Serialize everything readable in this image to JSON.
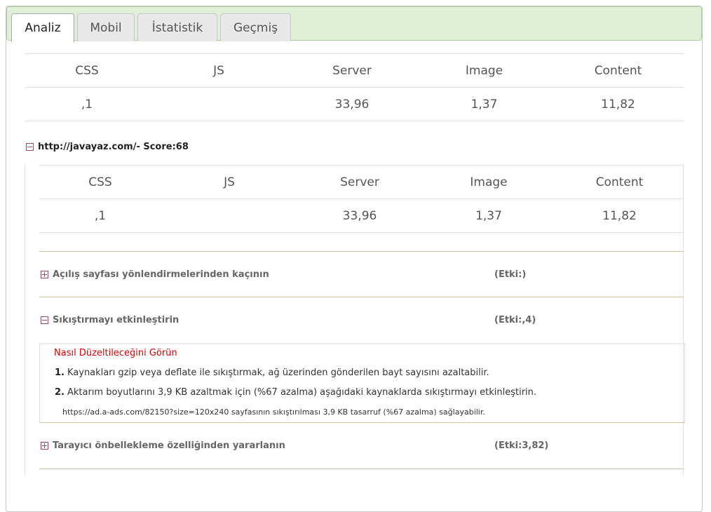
{
  "tabs": [
    {
      "label": "Analiz",
      "active": true
    },
    {
      "label": "Mobil",
      "active": false
    },
    {
      "label": "İstatistik",
      "active": false
    },
    {
      "label": "Geçmiş",
      "active": false
    }
  ],
  "summary": {
    "headers": [
      "CSS",
      "JS",
      "Server",
      "Image",
      "Content"
    ],
    "values": [
      ",1",
      "",
      "33,96",
      "1,37",
      "11,82"
    ]
  },
  "site": {
    "title": "http://javayaz.com/- Score:68",
    "headers": [
      "CSS",
      "JS",
      "Server",
      "Image",
      "Content"
    ],
    "values": [
      ",1",
      "",
      "33,96",
      "1,37",
      "11,82"
    ]
  },
  "rules": [
    {
      "title": "Açılış sayfası yönlendirmelerinden kaçının",
      "impact": "(Etki:)",
      "expanded": false
    },
    {
      "title": "Sıkıştırmayı etkinleştirin",
      "impact": "(Etki:,4)",
      "expanded": true
    },
    {
      "title": "Tarayıcı önbellekleme özelliğinden yararlanın",
      "impact": "(Etki:3,82)",
      "expanded": false
    }
  ],
  "detail": {
    "fix_link": "Nasıl Düzeltileceğini Görün",
    "steps": [
      {
        "num": "1.",
        "text": "Kaynakları gzip veya deflate ile sıkıştırmak, ağ üzerinden gönderilen bayt sayısını azaltabilir."
      },
      {
        "num": "2.",
        "text": "Aktarım boyutlarını 3,9 KB azaltmak için (%67 azalma) aşağıdaki kaynaklarda sıkıştırmayı etkinleştirin."
      }
    ],
    "resource_note": "https://ad.a-ads.com/82150?size=120x240 sayfasının sıkıştırılması 3,9 KB tasarruf (%67 azalma) sağlayabilir."
  }
}
